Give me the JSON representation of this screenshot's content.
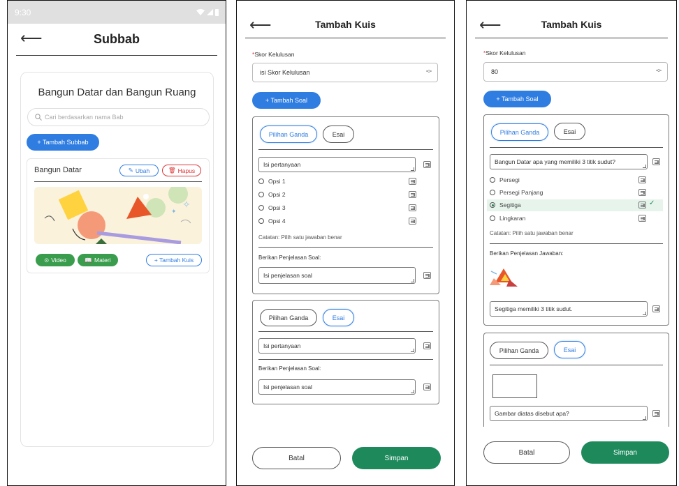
{
  "screen1": {
    "status_time": "9:30",
    "header_title": "Subbab",
    "bab_title": "Bangun Datar dan Bangun Ruang",
    "search_placeholder": "Cari berdasarkan nama Bab",
    "add_subbab_label": "+ Tambah Subbab",
    "subbab": {
      "name": "Bangun Datar",
      "edit_label": "Ubah",
      "delete_label": "Hapus",
      "video_label": "Video",
      "materi_label": "Materi",
      "add_quiz_label": "+ Tambah Kuis"
    },
    "colors": {
      "primary": "#2f7de1",
      "danger": "#dd3333",
      "success": "#3a9d4d"
    }
  },
  "screen2": {
    "header_title": "Tambah Kuis",
    "score_label": "Skor Kelulusan",
    "score_placeholder": "isi Skor Kelulusan",
    "add_question_label": "+ Tambah Soal",
    "q1": {
      "tab_pg": "Pilihan Ganda",
      "tab_esai": "Esai",
      "question_placeholder": "Isi pertanyaan",
      "options": [
        "Opsi 1",
        "Opsi 2",
        "Opsi 3",
        "Opsi 4"
      ],
      "note": "Catatan: Pilih satu jawaban benar",
      "explain_label": "Berikan Penjelasan Soal:",
      "explain_placeholder": "Isi penjelasan soal"
    },
    "q2": {
      "tab_pg": "Pilihan Ganda",
      "tab_esai": "Esai",
      "question_placeholder": "Isi pertanyaan",
      "explain_label": "Berikan Penjelasan Soal:",
      "explain_placeholder": "Isi penjelasan soal"
    },
    "cancel_label": "Batal",
    "save_label": "Simpan"
  },
  "screen3": {
    "header_title": "Tambah Kuis",
    "score_label": "Skor Kelulusan",
    "score_value": "80",
    "add_question_label": "+ Tambah Soal",
    "q1": {
      "tab_pg": "Pilihan Ganda",
      "tab_esai": "Esai",
      "question": "Bangun Datar apa yang memiliki 3 titik sudut?",
      "options": [
        "Persegi",
        "Persegi Panjang",
        "Segitiga",
        "Lingkaran"
      ],
      "selected_index": 2,
      "note": "Catatan: Pilih satu jawaban benar",
      "explain_label": "Berikan Penjelasan Jawaban:",
      "explain_value": "Segitiga memiliki 3 titik sudut."
    },
    "q2": {
      "tab_pg": "Pilihan Ganda",
      "tab_esai": "Esai",
      "question": "Gambar diatas disebut apa?"
    },
    "cancel_label": "Batal",
    "save_label": "Simpan",
    "colors": {
      "save": "#1e8a5c",
      "selected_bg": "#e6f4ec"
    }
  }
}
